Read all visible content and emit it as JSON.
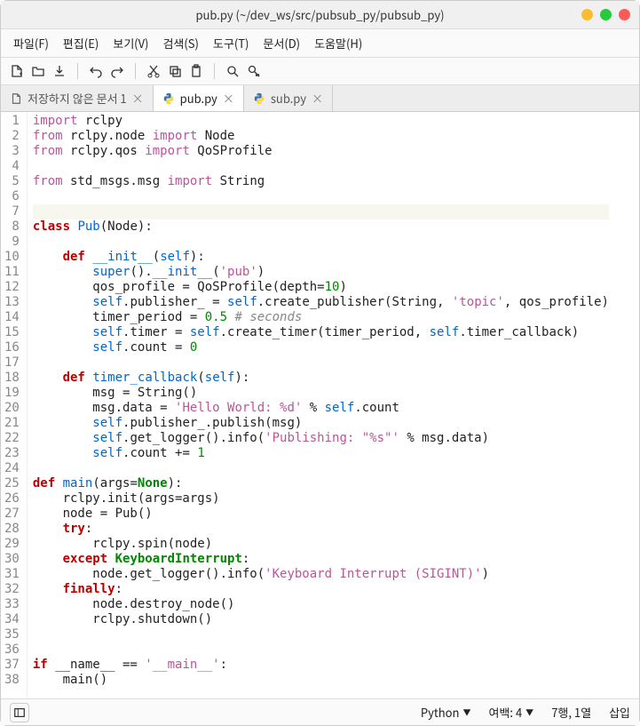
{
  "window": {
    "title": "pub.py (~/dev_ws/src/pubsub_py/pubsub_py)"
  },
  "menu": {
    "file": "파일(F)",
    "edit": "편집(E)",
    "view": "보기(V)",
    "search": "검색(S)",
    "tools": "도구(T)",
    "documents": "문서(D)",
    "help": "도움말(H)"
  },
  "tabs": [
    {
      "label": "저장하지 않은 문서 1",
      "icon": "document",
      "active": false
    },
    {
      "label": "pub.py",
      "icon": "python",
      "active": true
    },
    {
      "label": "sub.py",
      "icon": "python",
      "active": false
    }
  ],
  "code_lines": [
    [
      [
        "import",
        "k-import"
      ],
      [
        " rclpy",
        ""
      ]
    ],
    [
      [
        "from",
        "k-import"
      ],
      [
        " rclpy.node ",
        ""
      ],
      [
        "import",
        "k-import"
      ],
      [
        " Node",
        ""
      ]
    ],
    [
      [
        "from",
        "k-import"
      ],
      [
        " rclpy.qos ",
        ""
      ],
      [
        "import",
        "k-import"
      ],
      [
        " QoSProfile",
        ""
      ]
    ],
    [
      [
        "",
        ""
      ]
    ],
    [
      [
        "from",
        "k-import"
      ],
      [
        " std_msgs.msg ",
        ""
      ],
      [
        "import",
        "k-import"
      ],
      [
        " String",
        ""
      ]
    ],
    [
      [
        "",
        ""
      ]
    ],
    [
      [
        "",
        ""
      ]
    ],
    [
      [
        "class",
        "k-class"
      ],
      [
        " ",
        ""
      ],
      [
        "Pub",
        "k-type"
      ],
      [
        "(Node):",
        ""
      ]
    ],
    [
      [
        "",
        ""
      ]
    ],
    [
      [
        "    ",
        ""
      ],
      [
        "def",
        "k-def"
      ],
      [
        " ",
        ""
      ],
      [
        "__init__",
        "k-func"
      ],
      [
        "(",
        ""
      ],
      [
        "self",
        "k-self"
      ],
      [
        "):",
        ""
      ]
    ],
    [
      [
        "        ",
        ""
      ],
      [
        "super",
        "k-func"
      ],
      [
        "().",
        ""
      ],
      [
        "__init__",
        "k-func"
      ],
      [
        "(",
        ""
      ],
      [
        "'pub'",
        "k-string"
      ],
      [
        ")",
        ""
      ]
    ],
    [
      [
        "        qos_profile = QoSProfile(depth=",
        ""
      ],
      [
        "10",
        "k-number"
      ],
      [
        ")",
        ""
      ]
    ],
    [
      [
        "        ",
        ""
      ],
      [
        "self",
        "k-self"
      ],
      [
        ".publisher_ = ",
        ""
      ],
      [
        "self",
        "k-self"
      ],
      [
        ".create_publisher(String, ",
        ""
      ],
      [
        "'topic'",
        "k-string"
      ],
      [
        ", qos_profile)",
        ""
      ]
    ],
    [
      [
        "        timer_period = ",
        ""
      ],
      [
        "0.5",
        "k-number"
      ],
      [
        " ",
        ""
      ],
      [
        "# seconds",
        "k-comment"
      ]
    ],
    [
      [
        "        ",
        ""
      ],
      [
        "self",
        "k-self"
      ],
      [
        ".timer = ",
        ""
      ],
      [
        "self",
        "k-self"
      ],
      [
        ".create_timer(timer_period, ",
        ""
      ],
      [
        "self",
        "k-self"
      ],
      [
        ".timer_callback)",
        ""
      ]
    ],
    [
      [
        "        ",
        ""
      ],
      [
        "self",
        "k-self"
      ],
      [
        ".count = ",
        ""
      ],
      [
        "0",
        "k-number"
      ]
    ],
    [
      [
        "",
        ""
      ]
    ],
    [
      [
        "    ",
        ""
      ],
      [
        "def",
        "k-def"
      ],
      [
        " ",
        ""
      ],
      [
        "timer_callback",
        "k-func"
      ],
      [
        "(",
        ""
      ],
      [
        "self",
        "k-self"
      ],
      [
        "):",
        ""
      ]
    ],
    [
      [
        "        msg = String()",
        ""
      ]
    ],
    [
      [
        "        msg.data = ",
        ""
      ],
      [
        "'Hello World: %d'",
        "k-string"
      ],
      [
        " % ",
        ""
      ],
      [
        "self",
        "k-self"
      ],
      [
        ".count",
        ""
      ]
    ],
    [
      [
        "        ",
        ""
      ],
      [
        "self",
        "k-self"
      ],
      [
        ".publisher_.publish(msg)",
        ""
      ]
    ],
    [
      [
        "        ",
        ""
      ],
      [
        "self",
        "k-self"
      ],
      [
        ".get_logger().info(",
        ""
      ],
      [
        "'Publishing: \"%s\"'",
        "k-string"
      ],
      [
        " % msg.data)",
        ""
      ]
    ],
    [
      [
        "        ",
        ""
      ],
      [
        "self",
        "k-self"
      ],
      [
        ".count += ",
        ""
      ],
      [
        "1",
        "k-number"
      ]
    ],
    [
      [
        "",
        ""
      ]
    ],
    [
      [
        "def",
        "k-def"
      ],
      [
        " ",
        ""
      ],
      [
        "main",
        "k-func"
      ],
      [
        "(args=",
        ""
      ],
      [
        "None",
        "k-const"
      ],
      [
        "):",
        ""
      ]
    ],
    [
      [
        "    rclpy.init(args=args)",
        ""
      ]
    ],
    [
      [
        "    node = Pub()",
        ""
      ]
    ],
    [
      [
        "    ",
        ""
      ],
      [
        "try",
        "k-keyword"
      ],
      [
        ":",
        ""
      ]
    ],
    [
      [
        "        rclpy.spin(node)",
        ""
      ]
    ],
    [
      [
        "    ",
        ""
      ],
      [
        "except",
        "k-keyword"
      ],
      [
        " ",
        ""
      ],
      [
        "KeyboardInterrupt",
        "k-const"
      ],
      [
        ":",
        ""
      ]
    ],
    [
      [
        "        node.get_logger().info(",
        ""
      ],
      [
        "'Keyboard Interrupt (SIGINT)'",
        "k-string"
      ],
      [
        ")",
        ""
      ]
    ],
    [
      [
        "    ",
        ""
      ],
      [
        "finally",
        "k-keyword"
      ],
      [
        ":",
        ""
      ]
    ],
    [
      [
        "        node.destroy_node()",
        ""
      ]
    ],
    [
      [
        "        rclpy.shutdown()",
        ""
      ]
    ],
    [
      [
        "",
        ""
      ]
    ],
    [
      [
        "",
        ""
      ]
    ],
    [
      [
        "if",
        "k-keyword"
      ],
      [
        " __name__ == ",
        ""
      ],
      [
        "'__main__'",
        "k-string"
      ],
      [
        ":",
        ""
      ]
    ],
    [
      [
        "    main()",
        ""
      ]
    ]
  ],
  "highlighted_line": 7,
  "statusbar": {
    "language": "Python",
    "tabwidth_label": "여백: 4",
    "cursor": "7행, 1열",
    "insert_mode": "삽입"
  }
}
